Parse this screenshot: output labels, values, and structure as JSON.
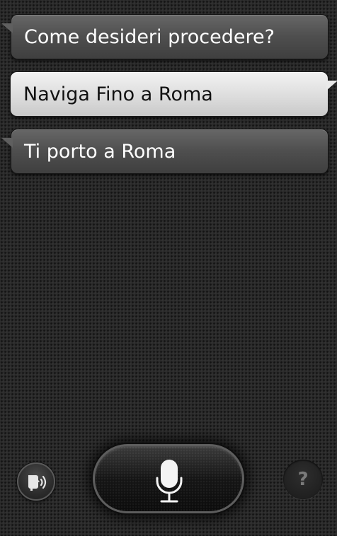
{
  "conversation": {
    "messages": [
      {
        "role": "assistant",
        "text": "Come desideri procedere?"
      },
      {
        "role": "user",
        "text": "Naviga Fino a Roma"
      },
      {
        "role": "assistant",
        "text": "Ti porto a Roma"
      }
    ]
  },
  "controls": {
    "tts_icon": "speaker-face-icon",
    "mic_icon": "microphone-icon",
    "help_label": "?"
  },
  "colors": {
    "background": "#2a2a2a",
    "assistant_bubble": "#4f4f4f",
    "user_bubble": "#dddddd",
    "assistant_text": "#ffffff",
    "user_text": "#111111"
  }
}
